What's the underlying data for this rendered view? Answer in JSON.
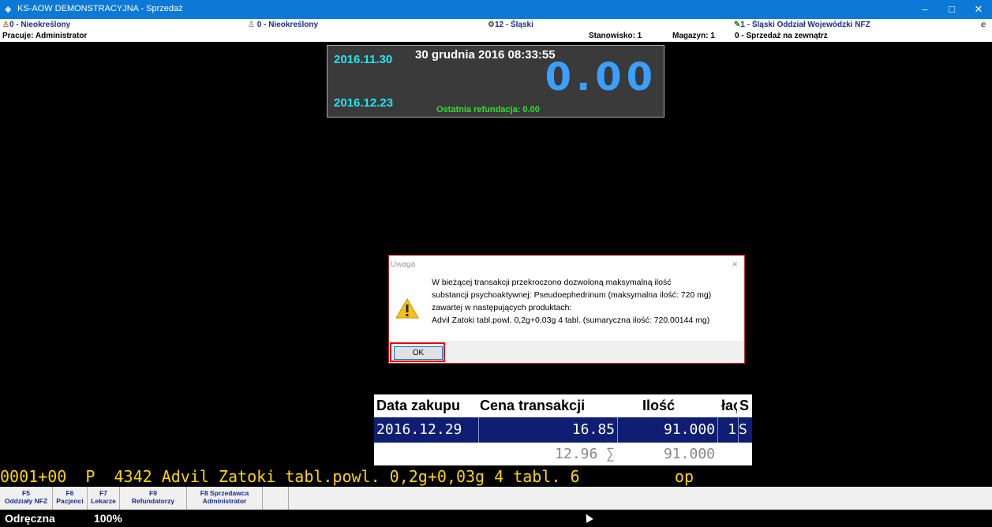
{
  "window": {
    "title": "KS-AOW DEMONSTRACYJNA - Sprzedaż",
    "minimize": "–",
    "maximize": "□",
    "close": "✕"
  },
  "info_row1": {
    "left": "0 - Nieokreślony",
    "center_left": "0 - Nieokreślony",
    "center": "12 - Śląski",
    "right": "1 - Śląski Oddział Wojewódzki NFZ",
    "corner": "ⅇ"
  },
  "info_row2": {
    "user": "Pracuje: Administrator",
    "station": "Stanowisko: 1",
    "warehouse": "Magazyn: 1",
    "sale_type": "0 - Sprzedaż na zewnątrz"
  },
  "display": {
    "date1": "2016.11.30",
    "date2": "2016.12.23",
    "datetime": "30 grudnia 2016  08:33:55",
    "amount": "0.00",
    "last_refund": "Ostatnia refundacja: 0.00"
  },
  "dialog": {
    "title": "Uwaga",
    "close": "×",
    "lines": [
      "W bieżącej transakcji przekroczono dozwoloną maksymalną ilość",
      "substancji psychoaktywnej: Pseudoephedrinum (maksymalna ilość: 720 mg)",
      "zawartej w następujących produktach:",
      "Advil Zatoki tabl.powl. 0,2g+0,03g 4 tabl. (sumaryczna ilość: 720.00144 mg)"
    ],
    "ok_label": "OK"
  },
  "table": {
    "headers": [
      "Data zakupu",
      "Cena transakcji",
      "Ilość",
      "łaç",
      "S"
    ],
    "row1": [
      "2016.12.29",
      "16.85",
      "91.000",
      "1",
      "S"
    ],
    "row2": [
      "",
      "12.96 ∑",
      "91.000",
      "",
      ""
    ]
  },
  "product_line": "0001+00  P  4342 Advil Zatoki tabl.powl. 0,2g+0,03g 4 tabl. 6          op",
  "fkeys": [
    {
      "key": "F5",
      "label": "Oddziały NFZ"
    },
    {
      "key": "F6",
      "label": "Pacjenci"
    },
    {
      "key": "F7",
      "label": "Lekarze"
    },
    {
      "key": "F9",
      "label": "Refundatorzy"
    },
    {
      "key": "F8 Sprzedawca",
      "label": "Administrator"
    }
  ],
  "status": {
    "mode": "Odręczna",
    "zoom": "100%"
  },
  "colors": {
    "titlebar": "#0c79d6",
    "display_dates": "#21e6f0",
    "amount": "#3aa0ff",
    "refund": "#2fe02f",
    "product_line": "#ffd400",
    "selected_row": "#0f1d73"
  }
}
